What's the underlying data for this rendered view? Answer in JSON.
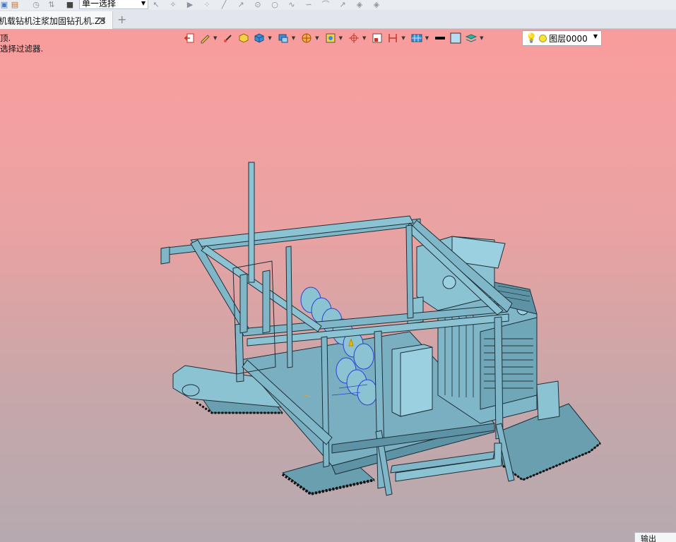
{
  "toolbar": {
    "selection_mode": "单一选择"
  },
  "tabs": {
    "document_title": "机载钻机注浆加固钻孔机.Z3",
    "close_glyph": "✕",
    "new_tab_glyph": "+"
  },
  "viewport": {
    "hint_line1": "顶.",
    "hint_line2": "选择过滤器."
  },
  "layer": {
    "name": "图层0000"
  },
  "output_panel": {
    "label": "输出"
  },
  "colors": {
    "model_fill": "#7fb7c9",
    "model_stroke": "#1d2f38",
    "auger_blue": "#2a3fd6",
    "bg_top": "#f99c9c",
    "bg_bottom": "#b5aab0"
  }
}
